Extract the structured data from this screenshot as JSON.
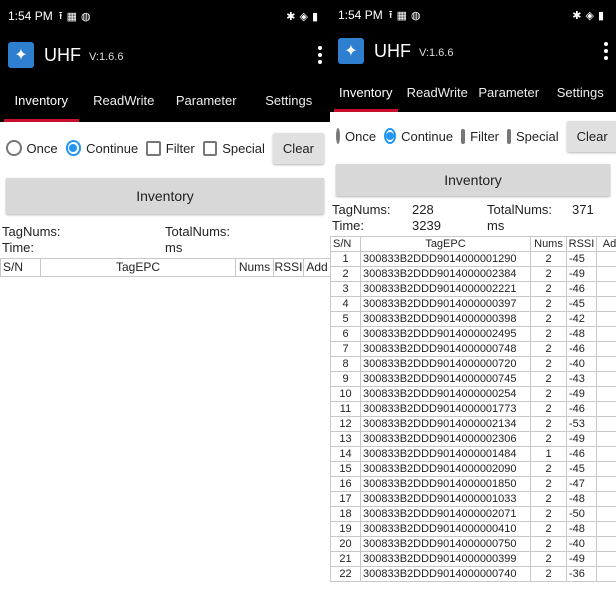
{
  "status": {
    "time": "1:54 PM"
  },
  "app": {
    "title": "UHF",
    "version": "V:1.6.6"
  },
  "tabs": [
    "Inventory",
    "ReadWrite",
    "Parameter",
    "Settings"
  ],
  "controls": {
    "once": "Once",
    "continue": "Continue",
    "filter": "Filter",
    "special": "Special",
    "clear": "Clear"
  },
  "inventory_button": "Inventory",
  "left": {
    "tag_nums_label": "TagNums:",
    "tag_nums": "",
    "total_nums_label": "TotalNums:",
    "total_nums": "",
    "time_label": "Time:",
    "time": "",
    "time_unit": "ms"
  },
  "right": {
    "tag_nums_label": "TagNums:",
    "tag_nums": "228",
    "total_nums_label": "TotalNums:",
    "total_nums": "371",
    "time_label": "Time:",
    "time": "3239",
    "time_unit": "ms"
  },
  "table": {
    "headers": [
      "S/N",
      "TagEPC",
      "Nums",
      "RSSI",
      "Add"
    ],
    "headers_right": [
      "S/N",
      "TagEPC",
      "Nums",
      "RSSI",
      "Ad"
    ],
    "rows": [
      {
        "sn": "1",
        "epc": "300833B2DDD9014000001290",
        "nums": "2",
        "rssi": "-45"
      },
      {
        "sn": "2",
        "epc": "300833B2DDD9014000002384",
        "nums": "2",
        "rssi": "-49"
      },
      {
        "sn": "3",
        "epc": "300833B2DDD9014000002221",
        "nums": "2",
        "rssi": "-46"
      },
      {
        "sn": "4",
        "epc": "300833B2DDD9014000000397",
        "nums": "2",
        "rssi": "-45"
      },
      {
        "sn": "5",
        "epc": "300833B2DDD9014000000398",
        "nums": "2",
        "rssi": "-42"
      },
      {
        "sn": "6",
        "epc": "300833B2DDD9014000002495",
        "nums": "2",
        "rssi": "-48"
      },
      {
        "sn": "7",
        "epc": "300833B2DDD9014000000748",
        "nums": "2",
        "rssi": "-46"
      },
      {
        "sn": "8",
        "epc": "300833B2DDD9014000000720",
        "nums": "2",
        "rssi": "-40"
      },
      {
        "sn": "9",
        "epc": "300833B2DDD9014000000745",
        "nums": "2",
        "rssi": "-43"
      },
      {
        "sn": "10",
        "epc": "300833B2DDD9014000000254",
        "nums": "2",
        "rssi": "-49"
      },
      {
        "sn": "11",
        "epc": "300833B2DDD9014000001773",
        "nums": "2",
        "rssi": "-46"
      },
      {
        "sn": "12",
        "epc": "300833B2DDD9014000002134",
        "nums": "2",
        "rssi": "-53"
      },
      {
        "sn": "13",
        "epc": "300833B2DDD9014000002306",
        "nums": "2",
        "rssi": "-49"
      },
      {
        "sn": "14",
        "epc": "300833B2DDD9014000001484",
        "nums": "1",
        "rssi": "-46"
      },
      {
        "sn": "15",
        "epc": "300833B2DDD9014000002090",
        "nums": "2",
        "rssi": "-45"
      },
      {
        "sn": "16",
        "epc": "300833B2DDD9014000001850",
        "nums": "2",
        "rssi": "-47"
      },
      {
        "sn": "17",
        "epc": "300833B2DDD9014000001033",
        "nums": "2",
        "rssi": "-48"
      },
      {
        "sn": "18",
        "epc": "300833B2DDD9014000002071",
        "nums": "2",
        "rssi": "-50"
      },
      {
        "sn": "19",
        "epc": "300833B2DDD9014000000410",
        "nums": "2",
        "rssi": "-48"
      },
      {
        "sn": "20",
        "epc": "300833B2DDD9014000000750",
        "nums": "2",
        "rssi": "-40"
      },
      {
        "sn": "21",
        "epc": "300833B2DDD9014000000399",
        "nums": "2",
        "rssi": "-49"
      },
      {
        "sn": "22",
        "epc": "300833B2DDD9014000000740",
        "nums": "2",
        "rssi": "-36"
      }
    ]
  }
}
